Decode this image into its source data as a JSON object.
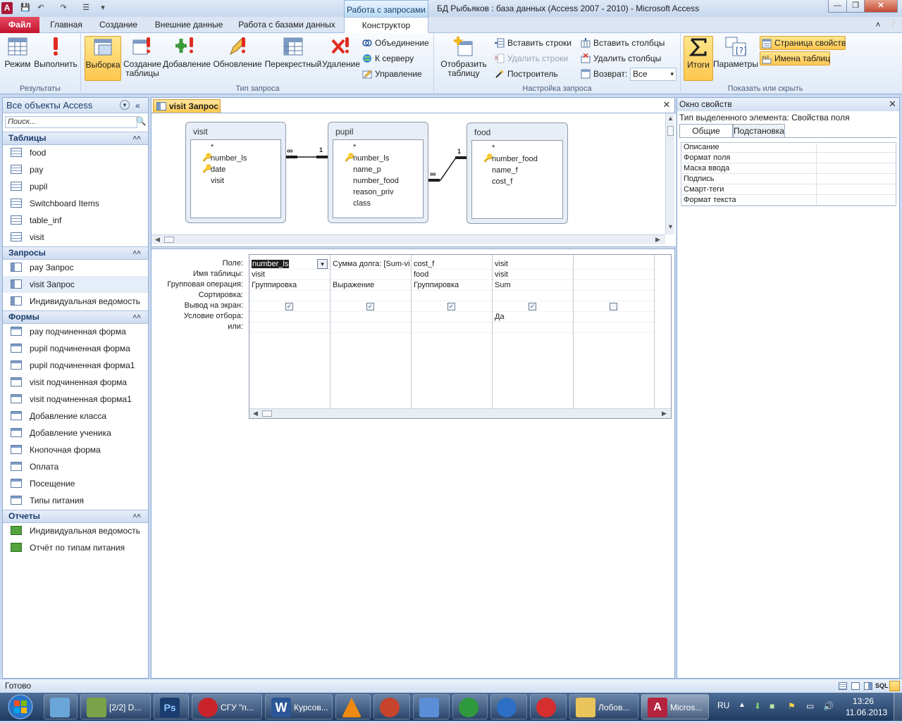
{
  "titlebar": {
    "context_tab": "Работа с запросами",
    "title": "БД Рыбьяков : база данных (Access 2007 - 2010)  -  Microsoft Access",
    "app_letter": "A"
  },
  "tabs": [
    "Файл",
    "Главная",
    "Создание",
    "Внешние данные",
    "Работа с базами данных",
    "Конструктор"
  ],
  "ribbon": {
    "results": {
      "label": "Результаты",
      "mode": "Режим",
      "run": "Выполнить"
    },
    "query_type": {
      "label": "Тип запроса",
      "select": "Выборка",
      "make_table": "Создание таблицы",
      "append": "Добавление",
      "update": "Обновление",
      "crosstab": "Перекрестный",
      "delete": "Удаление",
      "union": "Объединение",
      "passthrough": "К серверу",
      "ddl": "Управление"
    },
    "setup": {
      "label": "Настройка запроса",
      "show_table": "Отобразить таблицу",
      "insert_rows": "Вставить строки",
      "delete_rows": "Удалить строки",
      "builder": "Построитель",
      "insert_cols": "Вставить столбцы",
      "delete_cols": "Удалить столбцы",
      "return_label": "Возврат:",
      "return_value": "Все"
    },
    "showhide": {
      "label": "Показать или скрыть",
      "totals": "Итоги",
      "params": "Параметры",
      "property_sheet": "Страница свойств",
      "table_names": "Имена таблиц"
    }
  },
  "nav": {
    "header": "Все объекты Access",
    "search": "Поиск...",
    "tables": {
      "title": "Таблицы",
      "items": [
        "food",
        "pay",
        "pupil",
        "Switchboard Items",
        "table_inf",
        "visit"
      ]
    },
    "queries": {
      "title": "Запросы",
      "items": [
        "pay Запрос",
        "visit Запрос",
        "Индивидуальная ведомость"
      ]
    },
    "forms": {
      "title": "Формы",
      "items": [
        "pay подчиненная форма",
        "pupil подчиненная форма",
        "pupil подчиненная форма1",
        "visit подчиненная форма",
        "visit подчиненная форма1",
        "Добавление класса",
        "Добавление ученика",
        "Кнопочная форма",
        "Оплата",
        "Посещение",
        "Типы питания"
      ]
    },
    "reports": {
      "title": "Отчеты",
      "items": [
        "Индивидуальная ведомость",
        "Отчёт по типам питания"
      ]
    }
  },
  "doc": {
    "tab": "visit Запрос",
    "tables": [
      {
        "name": "visit",
        "fields": [
          "*",
          "number_ls",
          "date",
          "visit"
        ],
        "keys": [
          1,
          2
        ]
      },
      {
        "name": "pupil",
        "fields": [
          "*",
          "number_ls",
          "name_p",
          "number_food",
          "reason_priv",
          "class"
        ],
        "keys": [
          1
        ]
      },
      {
        "name": "food",
        "fields": [
          "*",
          "number_food",
          "name_f",
          "cost_f"
        ],
        "keys": [
          1
        ]
      }
    ],
    "rel": {
      "many": "∞",
      "one": "1"
    },
    "grid_labels": [
      "Поле:",
      "Имя таблицы:",
      "Групповая операция:",
      "Сортировка:",
      "Вывод на экран:",
      "Условие отбора:",
      "или:"
    ],
    "columns": [
      {
        "field": "number_ls",
        "table": "visit",
        "total": "Группировка",
        "criteria": "",
        "show": true
      },
      {
        "field": "Сумма долга: [Sum-vi",
        "table": "",
        "total": "Выражение",
        "criteria": "",
        "show": true
      },
      {
        "field": "cost_f",
        "table": "food",
        "total": "Группировка",
        "criteria": "",
        "show": true
      },
      {
        "field": "visit",
        "table": "visit",
        "total": "Sum",
        "criteria": "Да",
        "show": true
      },
      {
        "field": "",
        "table": "",
        "total": "",
        "criteria": "",
        "show": false
      }
    ]
  },
  "props": {
    "title": "Окно свойств",
    "seltype": "Тип выделенного элемента:  Свойства поля",
    "tab_general": "Общие",
    "tab_lookup": "Подстановка",
    "rows": [
      "Описание",
      "Формат поля",
      "Маска ввода",
      "Подпись",
      "Смарт-теги",
      "Формат текста"
    ]
  },
  "status": {
    "text": "Готово",
    "sql": "SQL"
  },
  "taskbar": {
    "items": [
      {
        "label": "",
        "color": "#6aa7d8"
      },
      {
        "label": "[2/2] D...",
        "color": "#7aa34a"
      },
      {
        "label": "",
        "color": "#1a3c6e"
      },
      {
        "label": "СГУ \"п...",
        "color": "#c8242a"
      },
      {
        "label": "Курсов...",
        "color": "#2b5797"
      },
      {
        "label": "",
        "color": "#f08a12"
      },
      {
        "label": "",
        "color": "#c7432b"
      },
      {
        "label": "",
        "color": "#5a8ed6"
      },
      {
        "label": "",
        "color": "#2f9a3d"
      },
      {
        "label": "",
        "color": "#2c6fc5"
      },
      {
        "label": "",
        "color": "#d62e2e"
      },
      {
        "label": "Лобов...",
        "color": "#e8c45a"
      },
      {
        "label": "Micros...",
        "color": "#b5233e"
      }
    ],
    "lang": "RU",
    "time": "13:26",
    "date": "11.06.2013"
  }
}
